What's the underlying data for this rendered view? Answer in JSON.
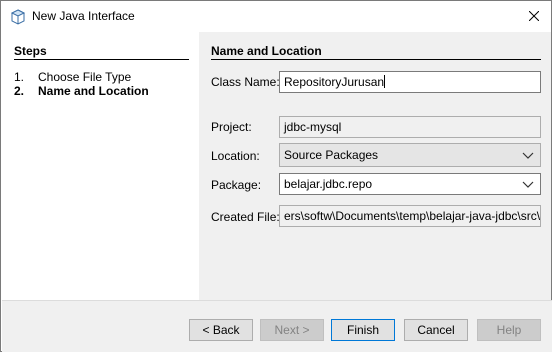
{
  "window": {
    "title": "New Java Interface"
  },
  "steps": {
    "heading": "Steps",
    "items": [
      {
        "number": "1.",
        "label": "Choose File Type"
      },
      {
        "number": "2.",
        "label": "Name and Location"
      }
    ]
  },
  "form": {
    "heading": "Name and Location",
    "class_name": {
      "label": "Class Name:",
      "value": "RepositoryJurusan"
    },
    "project": {
      "label": "Project:",
      "value": "jdbc-mysql"
    },
    "location": {
      "label": "Location:",
      "value": "Source Packages"
    },
    "package": {
      "label": "Package:",
      "value": "belajar.jdbc.repo"
    },
    "created_file": {
      "label": "Created File:",
      "value": "ers\\softw\\Documents\\temp\\belajar-java-jdbc\\src\\belajar"
    }
  },
  "buttons": {
    "back": "< Back",
    "next": "Next >",
    "finish": "Finish",
    "cancel": "Cancel",
    "help": "Help"
  },
  "icons": {
    "title": "netbeans-cube-icon",
    "close": "close-icon",
    "dropdown": "chevron-down-icon"
  },
  "colors": {
    "accent": "#0078d7",
    "panel_bg": "#f0f0f0"
  }
}
